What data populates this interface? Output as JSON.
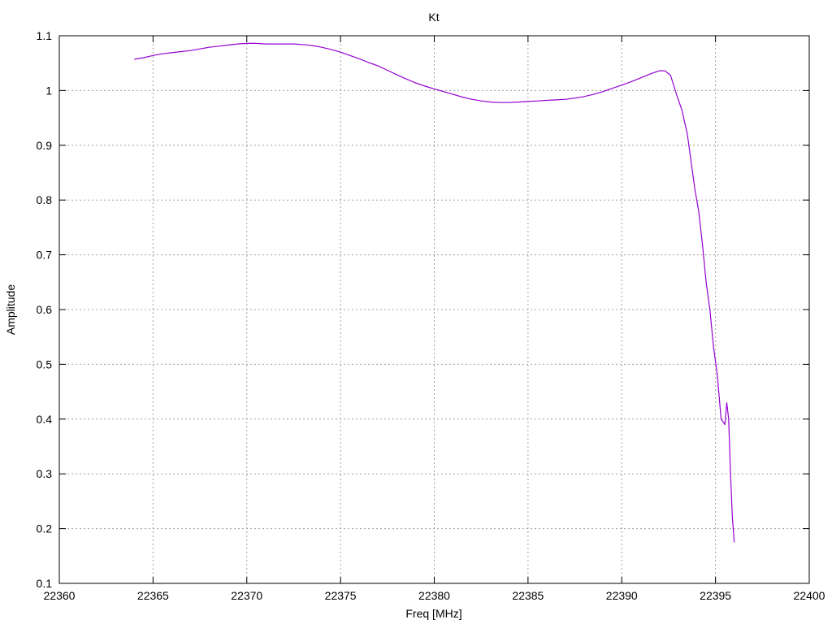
{
  "chart_data": {
    "type": "line",
    "title": "Kt",
    "xlabel": "Freq [MHz]",
    "ylabel": "Amplitude",
    "xlim": [
      22360,
      22400
    ],
    "ylim": [
      0.1,
      1.1
    ],
    "xticks": [
      22360,
      22365,
      22370,
      22375,
      22380,
      22385,
      22390,
      22395,
      22400
    ],
    "yticks": [
      0.1,
      0.2,
      0.3,
      0.4,
      0.5,
      0.6,
      0.7,
      0.8,
      0.9,
      1,
      1.1
    ],
    "grid": true,
    "series": [
      {
        "color": "#9400d3",
        "x": [
          22364.0,
          22364.5,
          22365.0,
          22365.5,
          22366.0,
          22366.5,
          22367.0,
          22367.5,
          22368.0,
          22368.5,
          22369.0,
          22369.5,
          22370.0,
          22370.5,
          22371.0,
          22371.5,
          22372.0,
          22372.5,
          22373.0,
          22373.5,
          22374.0,
          22374.5,
          22375.0,
          22375.5,
          22376.0,
          22376.5,
          22377.0,
          22377.5,
          22378.0,
          22378.5,
          22379.0,
          22379.5,
          22380.0,
          22380.5,
          22381.0,
          22381.5,
          22382.0,
          22382.5,
          22383.0,
          22383.5,
          22384.0,
          22384.5,
          22385.0,
          22385.5,
          22386.0,
          22386.5,
          22387.0,
          22387.5,
          22388.0,
          22388.5,
          22389.0,
          22389.5,
          22390.0,
          22390.5,
          22391.0,
          22391.5,
          22392.0,
          22392.3,
          22392.6,
          22392.9,
          22393.2,
          22393.5,
          22393.7,
          22393.9,
          22394.1,
          22394.3,
          22394.5,
          22394.7,
          22394.9,
          22395.1,
          22395.3,
          22395.5,
          22395.6,
          22395.7,
          22395.8,
          22395.9,
          22396.0
        ],
        "y": [
          1.057,
          1.06,
          1.064,
          1.067,
          1.069,
          1.071,
          1.073,
          1.076,
          1.079,
          1.081,
          1.083,
          1.085,
          1.086,
          1.086,
          1.085,
          1.085,
          1.085,
          1.085,
          1.084,
          1.082,
          1.079,
          1.075,
          1.07,
          1.064,
          1.058,
          1.051,
          1.045,
          1.037,
          1.029,
          1.021,
          1.014,
          1.008,
          1.003,
          0.998,
          0.993,
          0.988,
          0.984,
          0.981,
          0.979,
          0.978,
          0.978,
          0.979,
          0.98,
          0.981,
          0.982,
          0.983,
          0.984,
          0.986,
          0.989,
          0.993,
          0.998,
          1.004,
          1.01,
          1.016,
          1.023,
          1.03,
          1.036,
          1.036,
          1.028,
          0.995,
          0.965,
          0.92,
          0.87,
          0.82,
          0.78,
          0.72,
          0.65,
          0.6,
          0.53,
          0.48,
          0.4,
          0.39,
          0.43,
          0.4,
          0.3,
          0.22,
          0.175
        ]
      }
    ]
  }
}
